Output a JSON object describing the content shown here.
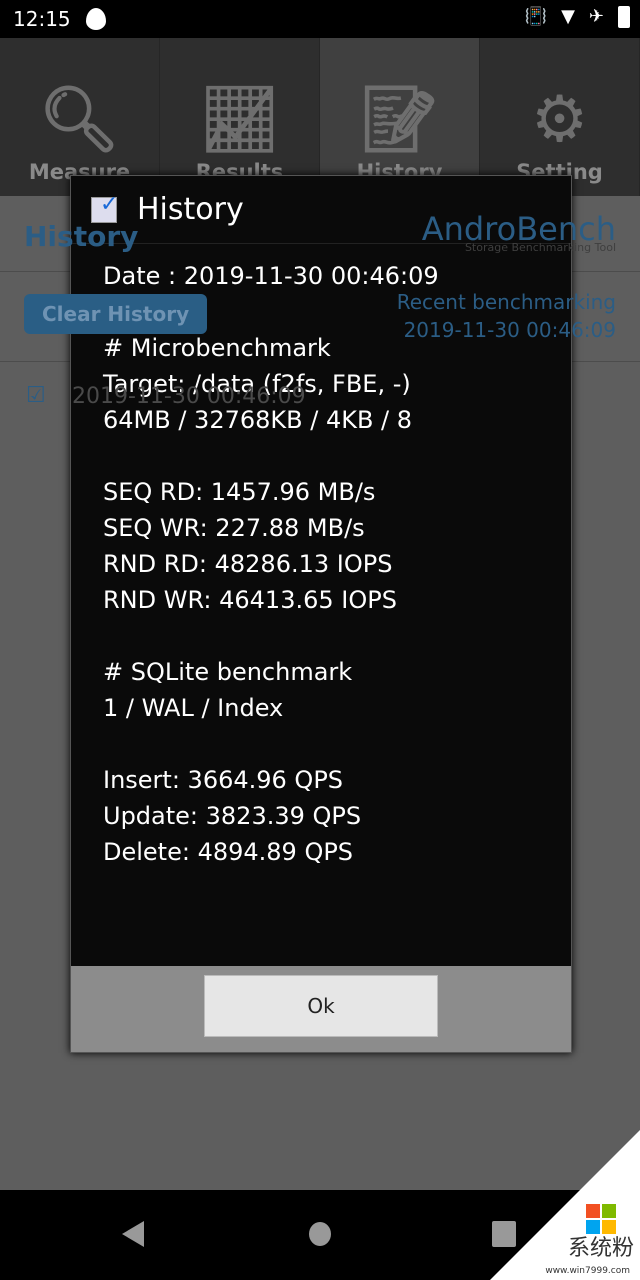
{
  "status_bar": {
    "time": "12:15",
    "icons": [
      "flame-icon",
      "vibrate-icon",
      "wifi-icon",
      "airplane-icon",
      "battery-icon"
    ]
  },
  "tabs": [
    {
      "label": "Measure",
      "icon": "search-icon"
    },
    {
      "label": "Results",
      "icon": "chart-icon"
    },
    {
      "label": "History",
      "icon": "document-edit-icon",
      "active": true
    },
    {
      "label": "Setting",
      "icon": "gears-icon"
    }
  ],
  "background": {
    "title": "History",
    "logo": "AndroBench",
    "tagline": "Storage Benchmarking Tool",
    "clear_button": "Clear History",
    "recent_label": "Recent benchmarking",
    "recent_date": "2019-11-30 00:46:09",
    "item": "2019-11-30 00:46:09"
  },
  "dialog": {
    "title": "History",
    "lines": [
      "Date : 2019-11-30 00:46:09",
      "",
      "# Microbenchmark",
      "Target: /data (f2fs, FBE, -)",
      "64MB / 32768KB / 4KB / 8",
      "",
      "SEQ RD: 1457.96 MB/s",
      "SEQ WR: 227.88 MB/s",
      "RND RD: 48286.13 IOPS",
      "RND WR: 46413.65 IOPS",
      "",
      "# SQLite benchmark",
      "1 / WAL / Index",
      "",
      "Insert: 3664.96 QPS",
      "Update: 3823.39 QPS",
      "Delete: 4894.89 QPS"
    ],
    "ok": "Ok"
  },
  "watermark": {
    "text": "系统粉",
    "url": "www.win7999.com"
  },
  "colors": {
    "accent": "#2a7ab8"
  }
}
